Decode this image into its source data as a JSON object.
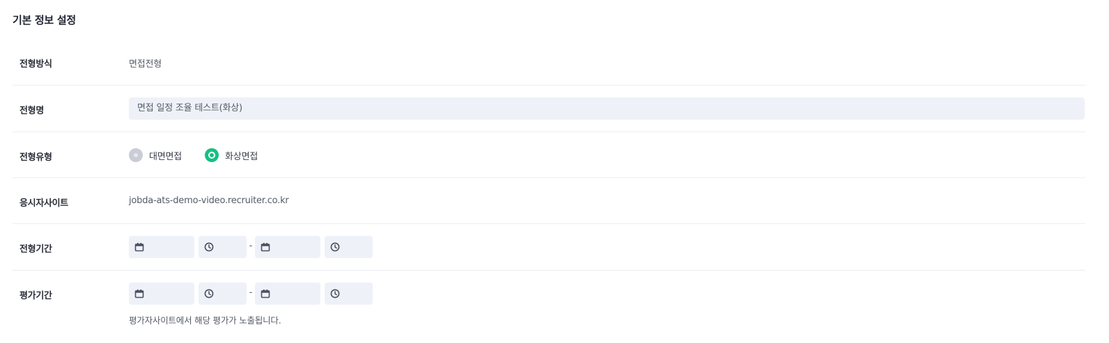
{
  "section": {
    "title": "기본 정보 설정"
  },
  "rows": {
    "method": {
      "label": "전형방식",
      "value": "면접전형"
    },
    "name": {
      "label": "전형명",
      "value": "면접 일정 조율 테스트(화상)"
    },
    "type": {
      "label": "전형유형",
      "options": [
        {
          "label": "대면면접",
          "selected": false
        },
        {
          "label": "화상면접",
          "selected": true
        }
      ]
    },
    "site": {
      "label": "응시자사이트",
      "value": "jobda-ats-demo-video.recruiter.co.kr"
    },
    "period": {
      "label": "전형기간",
      "separator": "-"
    },
    "eval_period": {
      "label": "평가기간",
      "separator": "-",
      "helper": "평가자사이트에서 해당 평가가 노출됩니다."
    }
  },
  "icons": {
    "date": "calendar-icon",
    "time": "clock-icon"
  },
  "colors": {
    "accent": "#16c083",
    "input_bg": "#eef1f8",
    "divider": "#eceef2"
  }
}
